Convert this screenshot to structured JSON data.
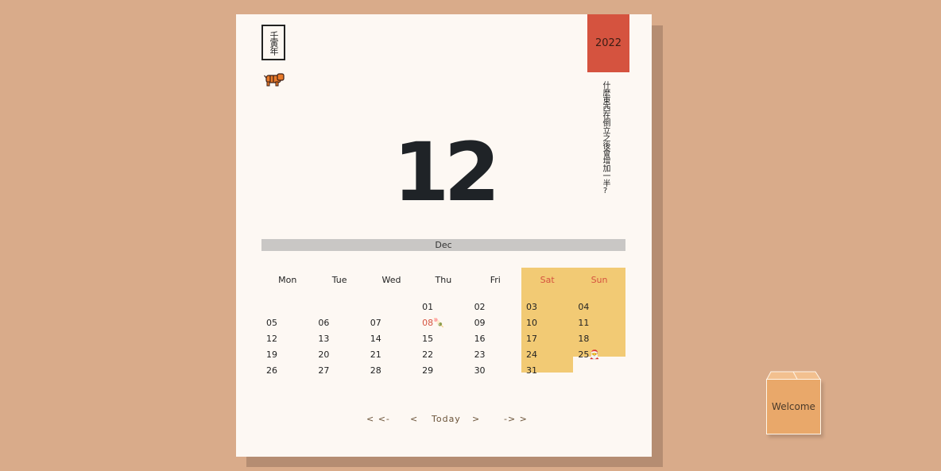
{
  "header": {
    "year_stamp": "壬寅年",
    "year": "2022",
    "riddle": "什麼東西在倒立之後會增加一半?",
    "zodiac_icon": "tiger-icon"
  },
  "day": "12",
  "month": "Dec",
  "weekdays": [
    "Mon",
    "Tue",
    "Wed",
    "Thu",
    "Fri",
    "Sat",
    "Sun"
  ],
  "weeks": [
    [
      "",
      "",
      "",
      "01",
      "02",
      "03",
      "04"
    ],
    [
      "05",
      "06",
      "07",
      "08",
      "09",
      "10",
      "11"
    ],
    [
      "12",
      "13",
      "14",
      "15",
      "16",
      "17",
      "18"
    ],
    [
      "19",
      "20",
      "21",
      "22",
      "23",
      "24",
      "25"
    ],
    [
      "26",
      "27",
      "28",
      "29",
      "30",
      "31",
      ""
    ]
  ],
  "holidays": {
    "08": {
      "icon": "dumpling-icon",
      "glyph": "🍡"
    },
    "25": {
      "icon": "santa-icon",
      "glyph": "🎅"
    }
  },
  "nav": {
    "prev_year": "< <-",
    "prev_month": "<",
    "today": "Today",
    "next_month": ">",
    "next_year": "-> >"
  },
  "welcome_label": "Welcome",
  "colors": {
    "background": "#d9ab8a",
    "card": "#fdf8f3",
    "accent": "#d5533f",
    "weekend": "#f2ca74"
  }
}
